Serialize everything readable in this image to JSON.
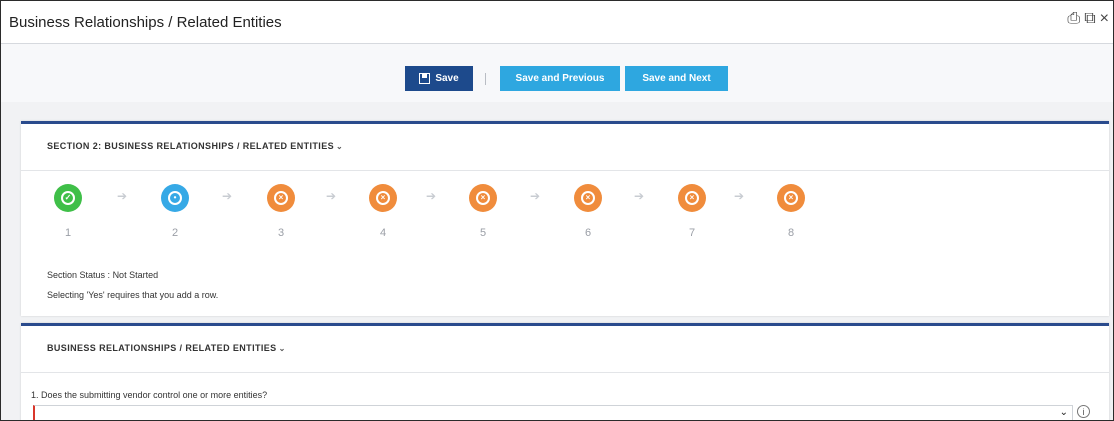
{
  "window": {
    "title": "Business Relationships / Related Entities",
    "icons": [
      "print-icon",
      "popout-icon",
      "close-icon"
    ],
    "icon_glyphs": [
      "⎙",
      "⧉",
      "×"
    ]
  },
  "toolbar": {
    "save_label": "Save",
    "save_prev_label": "Save and Previous",
    "save_next_label": "Save and Next"
  },
  "section": {
    "heading": "SECTION 2: BUSINESS RELATIONSHIPS / RELATED ENTITIES",
    "steps": [
      {
        "number": "1",
        "state": "complete",
        "color": "#3fbf48",
        "glyph": "✓"
      },
      {
        "number": "2",
        "state": "current",
        "color": "#36a9e6",
        "glyph": "•"
      },
      {
        "number": "3",
        "state": "not-started",
        "color": "#f08c3c",
        "glyph": "×"
      },
      {
        "number": "4",
        "state": "not-started",
        "color": "#f08c3c",
        "glyph": "×"
      },
      {
        "number": "5",
        "state": "not-started",
        "color": "#f08c3c",
        "glyph": "×"
      },
      {
        "number": "6",
        "state": "not-started",
        "color": "#f08c3c",
        "glyph": "×"
      },
      {
        "number": "7",
        "state": "not-started",
        "color": "#f08c3c",
        "glyph": "×"
      },
      {
        "number": "8",
        "state": "not-started",
        "color": "#f08c3c",
        "glyph": "×"
      }
    ],
    "status_label": "Section Status :",
    "status_value": "Not Started",
    "note": "Selecting 'Yes' requires that you add a row."
  },
  "subsection": {
    "heading": "BUSINESS RELATIONSHIPS / RELATED ENTITIES",
    "question": "1. Does the submitting vendor control one or more entities?",
    "answer_value": ""
  },
  "colors": {
    "primary": "#1d4a8c",
    "accent": "#2ea7e0",
    "card_border": "#2a4b8d",
    "required": "#d9362b"
  }
}
